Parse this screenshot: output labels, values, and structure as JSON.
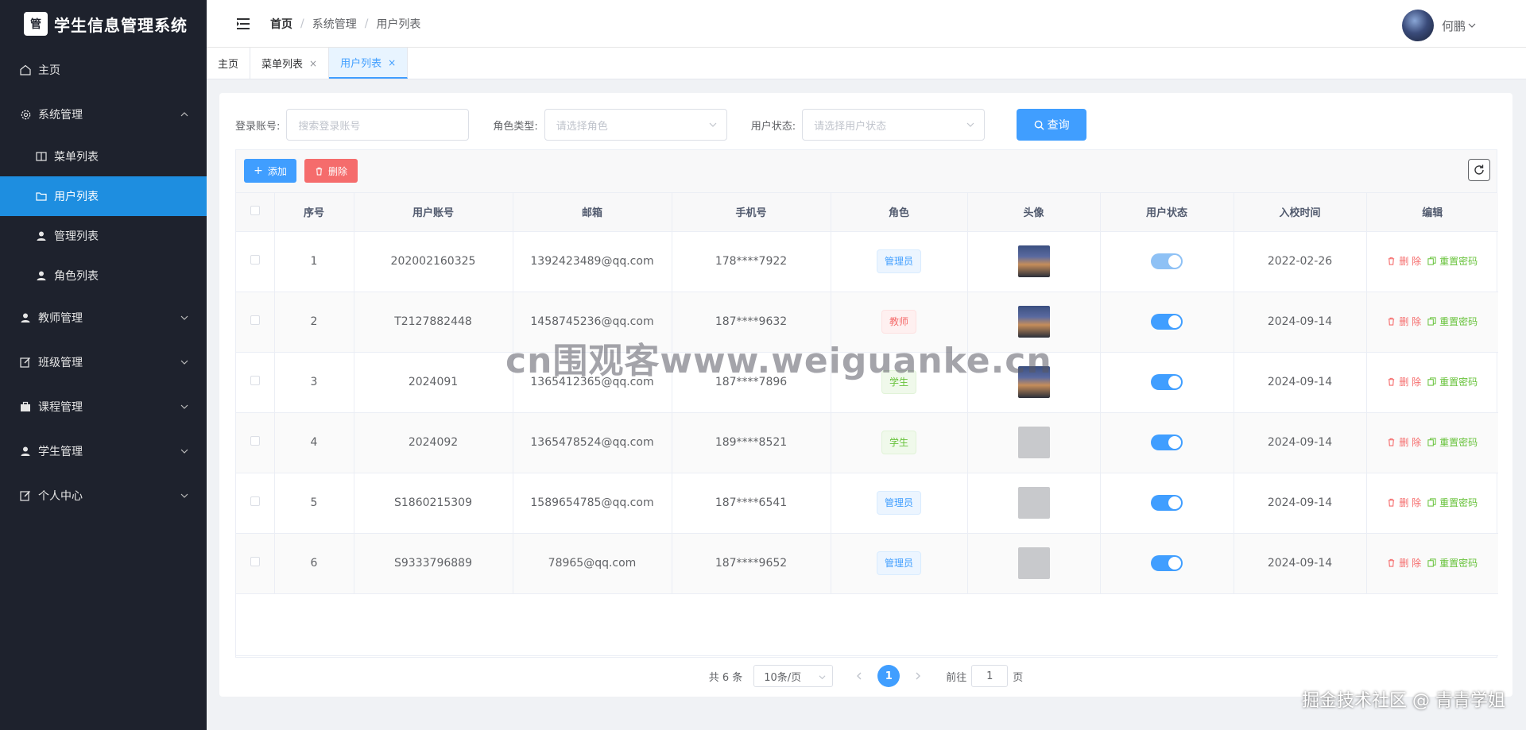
{
  "app": {
    "title": "学生信息管理系统",
    "logo_text": "管"
  },
  "sidebar": {
    "items": [
      {
        "label": "主页",
        "icon": "home-icon"
      },
      {
        "label": "系统管理",
        "icon": "gear-icon",
        "expanded": true,
        "children": [
          {
            "label": "菜单列表",
            "icon": "book-icon"
          },
          {
            "label": "用户列表",
            "icon": "folder-icon",
            "active": true
          },
          {
            "label": "管理列表",
            "icon": "user-icon"
          },
          {
            "label": "角色列表",
            "icon": "user-icon"
          }
        ]
      },
      {
        "label": "教师管理",
        "icon": "user-icon"
      },
      {
        "label": "班级管理",
        "icon": "edit-icon"
      },
      {
        "label": "课程管理",
        "icon": "briefcase-icon"
      },
      {
        "label": "学生管理",
        "icon": "user-icon"
      },
      {
        "label": "个人中心",
        "icon": "edit-icon"
      }
    ]
  },
  "header": {
    "breadcrumb": [
      "首页",
      "系统管理",
      "用户列表"
    ],
    "user_name": "何鹏"
  },
  "tabs": [
    {
      "label": "主页",
      "closable": false
    },
    {
      "label": "菜单列表",
      "closable": true
    },
    {
      "label": "用户列表",
      "closable": true,
      "active": true
    }
  ],
  "search": {
    "account_label": "登录账号:",
    "account_placeholder": "搜索登录账号",
    "role_label": "角色类型:",
    "role_placeholder": "请选择角色",
    "status_label": "用户状态:",
    "status_placeholder": "请选择用户状态",
    "query_button": "查询"
  },
  "toolbar": {
    "add_label": "添加",
    "delete_label": "删除"
  },
  "table": {
    "columns": [
      "序号",
      "用户账号",
      "邮箱",
      "手机号",
      "角色",
      "头像",
      "用户状态",
      "入校时间",
      "编辑"
    ],
    "rows": [
      {
        "index": "1",
        "account": "202002160325",
        "email": "1392423489@qq.com",
        "phone": "178****7922",
        "role": "管理员",
        "role_type": "admin",
        "avatar": "photo",
        "status": 1,
        "date": "2022-02-26"
      },
      {
        "index": "2",
        "account": "T2127882448",
        "email": "1458745236@qq.com",
        "phone": "187****9632",
        "role": "教师",
        "role_type": "teacher",
        "avatar": "photo",
        "status": 1,
        "date": "2024-09-14"
      },
      {
        "index": "3",
        "account": "2024091",
        "email": "1365412365@qq.com",
        "phone": "187****7896",
        "role": "学生",
        "role_type": "student",
        "avatar": "photo",
        "status": 1,
        "date": "2024-09-14"
      },
      {
        "index": "4",
        "account": "2024092",
        "email": "1365478524@qq.com",
        "phone": "189****8521",
        "role": "学生",
        "role_type": "student",
        "avatar": "blank",
        "status": 1,
        "date": "2024-09-14"
      },
      {
        "index": "5",
        "account": "S1860215309",
        "email": "1589654785@qq.com",
        "phone": "187****6541",
        "role": "管理员",
        "role_type": "admin",
        "avatar": "blank",
        "status": 1,
        "date": "2024-09-14"
      },
      {
        "index": "6",
        "account": "S9333796889",
        "email": "78965@qq.com",
        "phone": "187****9652",
        "role": "管理员",
        "role_type": "admin",
        "avatar": "blank",
        "status": 1,
        "date": "2024-09-14"
      }
    ],
    "op_delete": "删 除",
    "op_reset": "重置密码"
  },
  "pagination": {
    "total": "共 6 条",
    "page_size": "10条/页",
    "current_page": "1",
    "goto_label": "前往",
    "goto_value": "1",
    "goto_suffix": "页"
  },
  "overlays": {
    "watermark": "cn围观客www.weiguanke.cn",
    "source": "掘金技术社区 @ 青青学姐"
  }
}
